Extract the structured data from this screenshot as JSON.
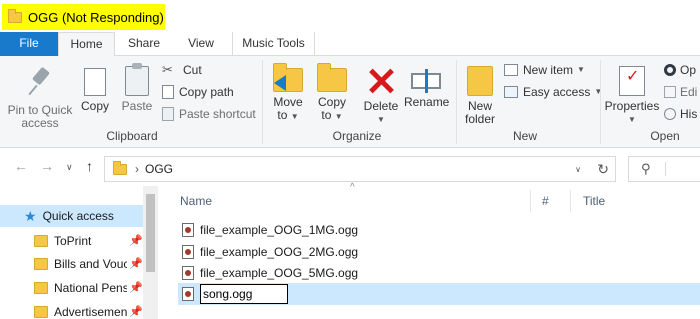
{
  "window": {
    "title": "OGG (Not Responding)"
  },
  "ribbon_tabs": [
    "File",
    "Home",
    "Share",
    "View",
    "Music Tools"
  ],
  "clipboard": {
    "pin_label_1": "Pin to Quick",
    "pin_label_2": "access",
    "copy": "Copy",
    "paste": "Paste",
    "cut": "Cut",
    "copy_path": "Copy path",
    "paste_shortcut": "Paste shortcut",
    "group": "Clipboard"
  },
  "organize": {
    "move_to_1": "Move",
    "move_to_2": "to",
    "copy_to_1": "Copy",
    "copy_to_2": "to",
    "delete": "Delete",
    "rename": "Rename",
    "group": "Organize"
  },
  "new": {
    "new_folder_1": "New",
    "new_folder_2": "folder",
    "new_item": "New item",
    "easy_access": "Easy access",
    "group": "New"
  },
  "open": {
    "properties": "Properties",
    "open_item": "Op",
    "edit_item": "Edi",
    "history_item": "His",
    "group": "Open"
  },
  "address": {
    "path": "OGG"
  },
  "nav_pane": {
    "quick_access": "Quick access",
    "items": [
      "ToPrint",
      "Bills and Vouc",
      "National Pens",
      "Advertisemen"
    ]
  },
  "file_list": {
    "columns": [
      "Name",
      "#",
      "Title"
    ],
    "files": [
      "file_example_OOG_1MG.ogg",
      "file_example_OOG_2MG.ogg",
      "file_example_OOG_5MG.ogg"
    ],
    "rename_value": "song.ogg"
  }
}
